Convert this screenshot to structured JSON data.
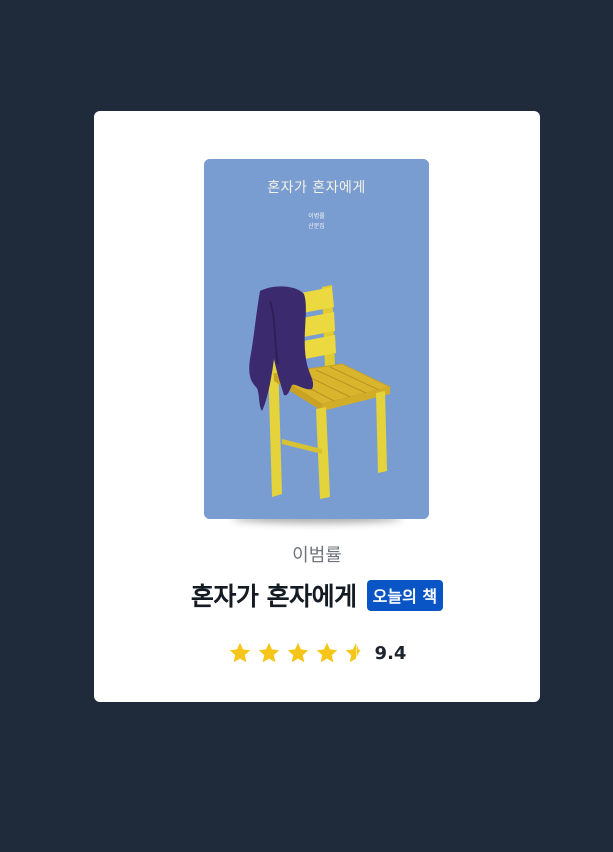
{
  "book": {
    "cover": {
      "title": "혼자가 혼자에게",
      "credit_line_1": "이병률",
      "credit_line_2": "산문집",
      "background_color": "#7a9dd1"
    },
    "author": "이범률",
    "title": "혼자가 혼자에게",
    "badge": "오늘의 책",
    "rating": {
      "score": "9.4",
      "stars_filled": 4.5,
      "stars_total": 5,
      "star_color": "#f5c518"
    }
  },
  "colors": {
    "page_background": "#1f2b3b",
    "card_background": "#ffffff",
    "badge_background": "#0a55c6"
  }
}
